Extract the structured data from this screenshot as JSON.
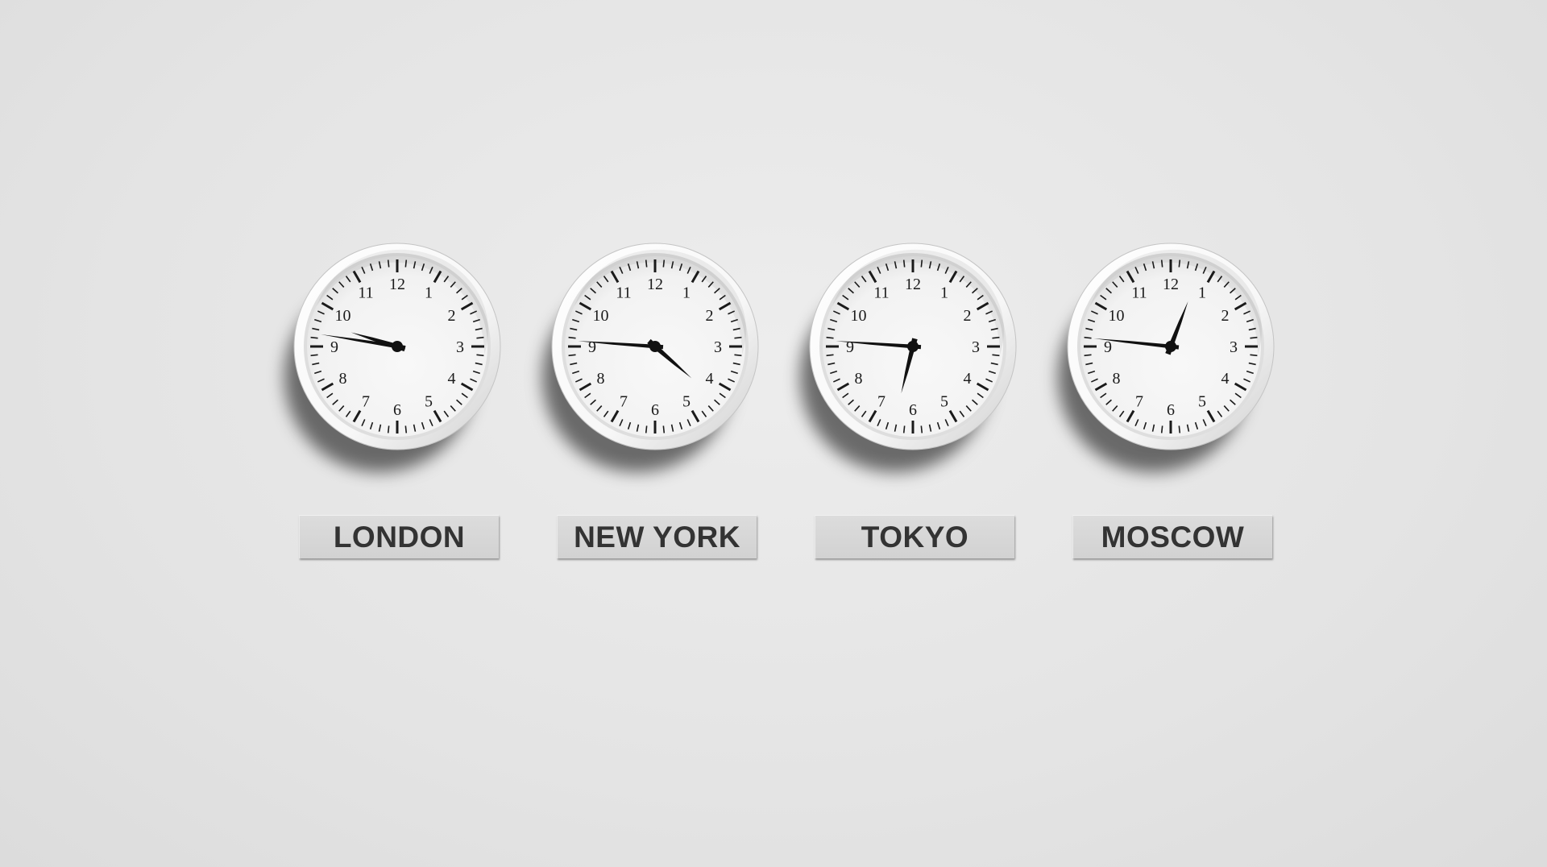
{
  "scene": {
    "background_color": "#e6e6e6",
    "clock_face_color": "#f2f2f2",
    "clock_rim_color": "#f7f7f7",
    "hand_color": "#111111",
    "plaque_color": "#d6d6d6",
    "plaque_text_color": "#333333"
  },
  "dial_numerals": [
    "12",
    "1",
    "2",
    "3",
    "4",
    "5",
    "6",
    "7",
    "8",
    "9",
    "10",
    "11"
  ],
  "clocks": [
    {
      "city": "LONDON",
      "hour_hand_deg": 287,
      "minute_hand_deg": 279
    },
    {
      "city": "NEW YORK",
      "hour_hand_deg": 131,
      "minute_hand_deg": 274
    },
    {
      "city": "TOKYO",
      "hour_hand_deg": 194,
      "minute_hand_deg": 274
    },
    {
      "city": "MOSCOW",
      "hour_hand_deg": 21,
      "minute_hand_deg": 276
    }
  ]
}
